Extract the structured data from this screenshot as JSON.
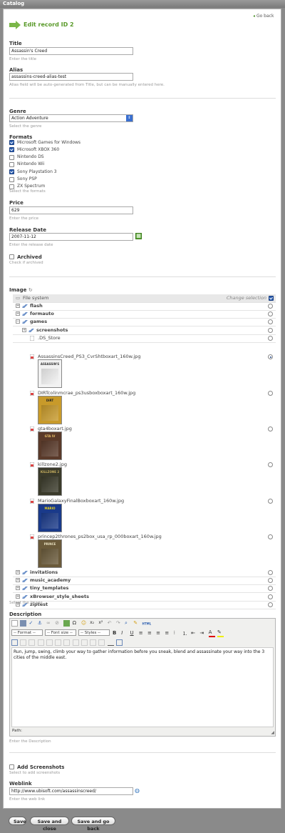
{
  "window": {
    "title": "Catalog"
  },
  "header": {
    "go_back": "Go back",
    "heading": "Edit record ID 2"
  },
  "fields": {
    "title": {
      "label": "Title",
      "value": "Assassin's Creed",
      "help": "Enter the title"
    },
    "alias": {
      "label": "Alias",
      "value": "assassins-creed-alias-test",
      "help": "Alias field will be auto-generated from Title, but can be manually entered here."
    },
    "genre": {
      "label": "Genre",
      "value": "Action Adventure",
      "help": "Select the genre"
    },
    "formats": {
      "label": "Formats",
      "help": "Select the formats",
      "options": [
        {
          "label": "Microsoft Games for Windows",
          "checked": true
        },
        {
          "label": "Microsoft XBOX 360",
          "checked": true
        },
        {
          "label": "Nintendo DS",
          "checked": false
        },
        {
          "label": "Nintendo Wii",
          "checked": false
        },
        {
          "label": "Sony Playstation 3",
          "checked": true
        },
        {
          "label": "Sony PSP",
          "checked": false
        },
        {
          "label": "ZX Spectrum",
          "checked": false
        }
      ]
    },
    "price": {
      "label": "Price",
      "value": "629",
      "help": "Enter the price"
    },
    "release_date": {
      "label": "Release Date",
      "value": "2007-11-12",
      "help": "Enter the release date"
    },
    "archived": {
      "label": "Archived",
      "checked": false,
      "help": "Check if archived"
    },
    "image": {
      "label": "Image",
      "help": "Select the Image",
      "root": "File system",
      "change_selection": "Change selection",
      "folders_top": [
        "flash",
        "formauto",
        "games"
      ],
      "subfolder": "screenshots",
      "files": [
        {
          "name": ".DS_Store",
          "selected": false
        },
        {
          "name": "AssassinsCreed_PS3_CvrShtboxart_160w.jpg",
          "selected": true
        },
        {
          "name": "DIRTcolinmcrae_ps3usboxboxart_160w.jpg",
          "selected": false
        },
        {
          "name": "gta4boxart.jpg",
          "selected": false
        },
        {
          "name": "killzone2.jpg",
          "selected": false
        },
        {
          "name": "MarioGalaxyFinalBoxboxart_160w.jpg",
          "selected": false
        },
        {
          "name": "princep2thrones_ps2box_usa_rp_000boxart_160w.jpg",
          "selected": false
        }
      ],
      "thumb_texts": [
        "ASSASSIN'S",
        "DiRT",
        "GTA IV",
        "KILLZONE 2",
        "MARIO",
        "PRINCE"
      ],
      "folders_bottom": [
        "invitations",
        "music_academy",
        "tiny_templates",
        "xBrowser_style_sheets",
        "ziptest"
      ]
    },
    "description": {
      "label": "Description",
      "format_select": "-- Format --",
      "font_size_select": "-- Font size --",
      "styles_select": "-- Styles --",
      "html_label": "HTML",
      "content": "Run, jump, swing, climb your way to gather information before you sneak, blend and assassinate your way into the 3 cities of the middle east.",
      "path_label": "Path:",
      "help": "Enter the Description"
    },
    "add_screenshots": {
      "label": "Add Screenshots",
      "checked": false,
      "help": "Select to add screenshots"
    },
    "weblink": {
      "label": "Weblink",
      "value": "http://www.ubisoft.com/assassinscreed/",
      "help": "Enter the web link"
    }
  },
  "buttons": {
    "save": "Save",
    "save_close": "Save and close",
    "save_back": "Save and go back"
  },
  "colors": {
    "accent_green": "#6aa84f",
    "selection_blue": "#2a5db0",
    "chrome_gray": "#8a8a8a"
  }
}
